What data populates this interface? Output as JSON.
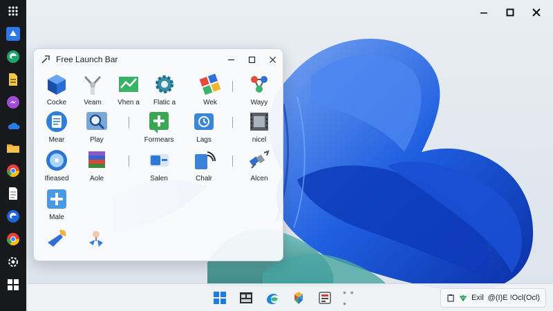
{
  "window": {
    "title": "Free Launch Bar",
    "icon": "launch-bar-icon"
  },
  "launcher": {
    "items": [
      {
        "label": "Cocke",
        "icon": "cube-icon"
      },
      {
        "label": "Veam",
        "icon": "tools-icon"
      },
      {
        "label": "Vhen a",
        "icon": "chart-icon"
      },
      {
        "label": "Flatic a",
        "icon": "gear-icon"
      },
      {
        "label": "Wek",
        "icon": "puzzle-icon"
      },
      {
        "label": "Wayy",
        "icon": "molecule-icon"
      },
      {
        "label": "Mear",
        "icon": "notepad-icon"
      },
      {
        "label": "Play",
        "icon": "magnifier-icon"
      },
      {
        "label": "Formears",
        "icon": "plus-icon"
      },
      {
        "label": "Lags",
        "icon": "clock-icon"
      },
      {
        "label": "nicel",
        "icon": "film-icon"
      },
      {
        "label": "Ifieased",
        "icon": "disc-icon"
      },
      {
        "label": "Aole",
        "icon": "stack-icon"
      },
      {
        "label": "Salen",
        "icon": "toggle-icon"
      },
      {
        "label": "Chalr",
        "icon": "signal-icon"
      },
      {
        "label": "Alcen",
        "icon": "satellite-icon"
      },
      {
        "label": "Male",
        "icon": "add-tile-icon"
      },
      {
        "label": "",
        "icon": "plane-icon"
      },
      {
        "label": "",
        "icon": "pin-icon"
      }
    ]
  },
  "taskbar": {
    "items": [
      {
        "icon": "start-icon"
      },
      {
        "icon": "task-view-icon"
      },
      {
        "icon": "edge-icon"
      },
      {
        "icon": "photos-icon"
      },
      {
        "icon": "tool-icon"
      }
    ],
    "more": "• • •",
    "tray": {
      "label_1": "Exil",
      "label_2": "@(I)E !Ocl(Ocl)"
    }
  },
  "dock": {
    "items": [
      {
        "icon": "grid-dots-icon"
      },
      {
        "icon": "launcher-icon"
      },
      {
        "icon": "edge-icon"
      },
      {
        "icon": "file-icon"
      },
      {
        "icon": "messenger-icon"
      },
      {
        "icon": "onedrive-icon"
      },
      {
        "icon": "file-explorer-icon"
      },
      {
        "icon": "chrome-icon"
      },
      {
        "icon": "document-icon"
      },
      {
        "icon": "edge-icon"
      },
      {
        "icon": "chrome-icon"
      },
      {
        "icon": "settings-icon"
      },
      {
        "icon": "windows-icon"
      }
    ]
  },
  "colors": {
    "accent": "#1f6fd6",
    "dock_bg": "#17191c",
    "wallpaper_blue": "#1e58d6"
  }
}
